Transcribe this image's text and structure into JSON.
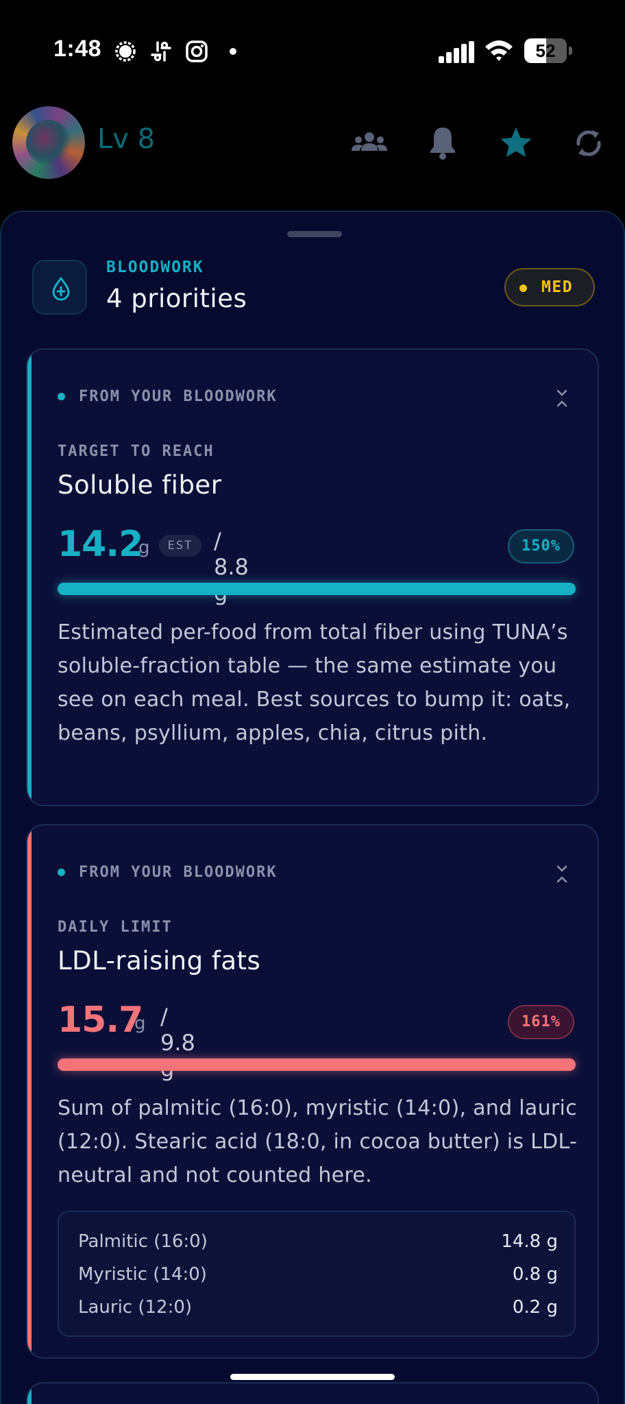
{
  "status_bar": {
    "time": "1:48",
    "battery": "52",
    "icons": [
      "signal-messenger-icon",
      "slack-icon",
      "instagram-icon",
      "notification-dot",
      "cellular-signal-icon",
      "wifi-icon",
      "battery-icon"
    ]
  },
  "header": {
    "level": "Lv 8",
    "icons": [
      "friends-icon",
      "bell-icon",
      "star-icon",
      "sync-icon"
    ]
  },
  "sheet": {
    "section_label": "BLOODWORK",
    "title": "4 priorities",
    "severity_badge": "MED",
    "colors": {
      "accent_teal": "#17b1c5",
      "accent_coral": "#f47479",
      "severity_yellow": "#f2c21a"
    }
  },
  "cards": [
    {
      "source": "FROM YOUR BLOODWORK",
      "kind": "TARGET TO REACH",
      "name": "Soluble fiber",
      "value": "14.2",
      "unit": "g",
      "est": "EST",
      "target": "/ 8.8 g",
      "percent": "150%",
      "progress": 1.0,
      "description": "Estimated per-food from total fiber using TUNA’s soluble-fraction table — the same estimate you see on each meal. Best sources to bump it: oats, beans, psyllium, apples, chia, citrus pith."
    },
    {
      "source": "FROM YOUR BLOODWORK",
      "kind": "DAILY LIMIT",
      "name": "LDL-raising fats",
      "value": "15.7",
      "unit": "g",
      "target": "/ 9.8 g",
      "percent": "161%",
      "progress": 1.0,
      "description": "Sum of palmitic (16:0), myristic (14:0), and lauric (12:0). Stearic acid (18:0, in cocoa butter) is LDL-neutral and not counted here.",
      "breakdown": [
        {
          "label": "Palmitic (16:0)",
          "value": "14.8 g"
        },
        {
          "label": "Myristic (14:0)",
          "value": "0.8 g"
        },
        {
          "label": "Lauric (12:0)",
          "value": "0.2 g"
        }
      ]
    }
  ]
}
